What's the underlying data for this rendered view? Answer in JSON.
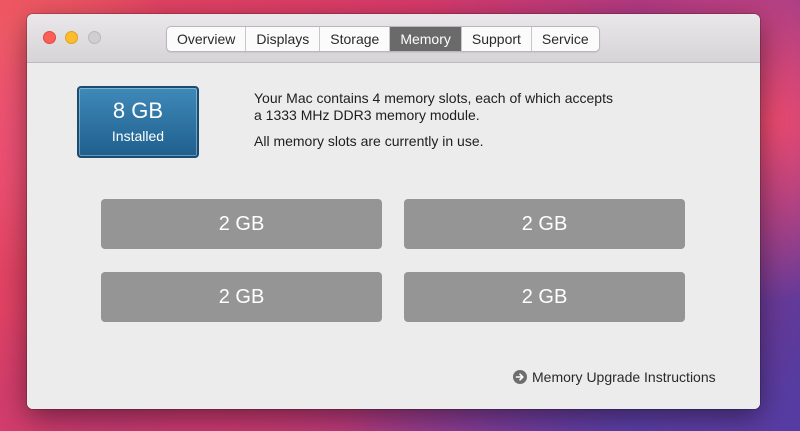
{
  "tabs": [
    {
      "label": "Overview"
    },
    {
      "label": "Displays"
    },
    {
      "label": "Storage"
    },
    {
      "label": "Memory",
      "active": true
    },
    {
      "label": "Support"
    },
    {
      "label": "Service"
    }
  ],
  "summary": {
    "size": "8 GB",
    "label": "Installed"
  },
  "description": {
    "line1": "Your Mac contains 4 memory slots, each of which accepts",
    "line2": "a 1333 MHz DDR3 memory module.",
    "status": "All memory slots are currently in use."
  },
  "slots": [
    {
      "size": "2 GB"
    },
    {
      "size": "2 GB"
    },
    {
      "size": "2 GB"
    },
    {
      "size": "2 GB"
    }
  ],
  "link": {
    "label": "Memory Upgrade Instructions",
    "icon": "arrow-circle-right-icon"
  },
  "colors": {
    "active_tab": "#6b6a6b",
    "badge": "#2f72a3",
    "slot": "#959595"
  }
}
